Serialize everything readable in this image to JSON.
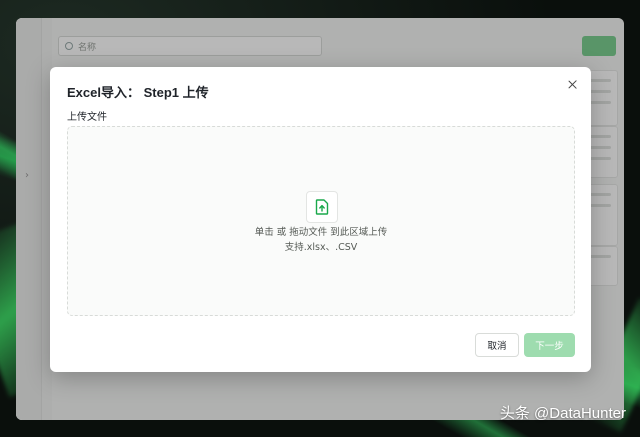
{
  "background": {
    "search_placeholder": "名称",
    "primary_button_label": ""
  },
  "modal": {
    "title": "Excel导入： Step1 上传",
    "field_label": "上传文件",
    "upload_hint": "单击 或 拖动文件 到此区域上传",
    "supported_formats": "支持.xlsx、.CSV",
    "cancel_label": "取消",
    "next_label": "下一步",
    "icons": {
      "close": "close-icon",
      "upload": "file-upload-icon"
    }
  },
  "colors": {
    "accent": "#1aa84b",
    "disabled_primary": "#9edcaf"
  },
  "watermark": "头条 @DataHunter"
}
